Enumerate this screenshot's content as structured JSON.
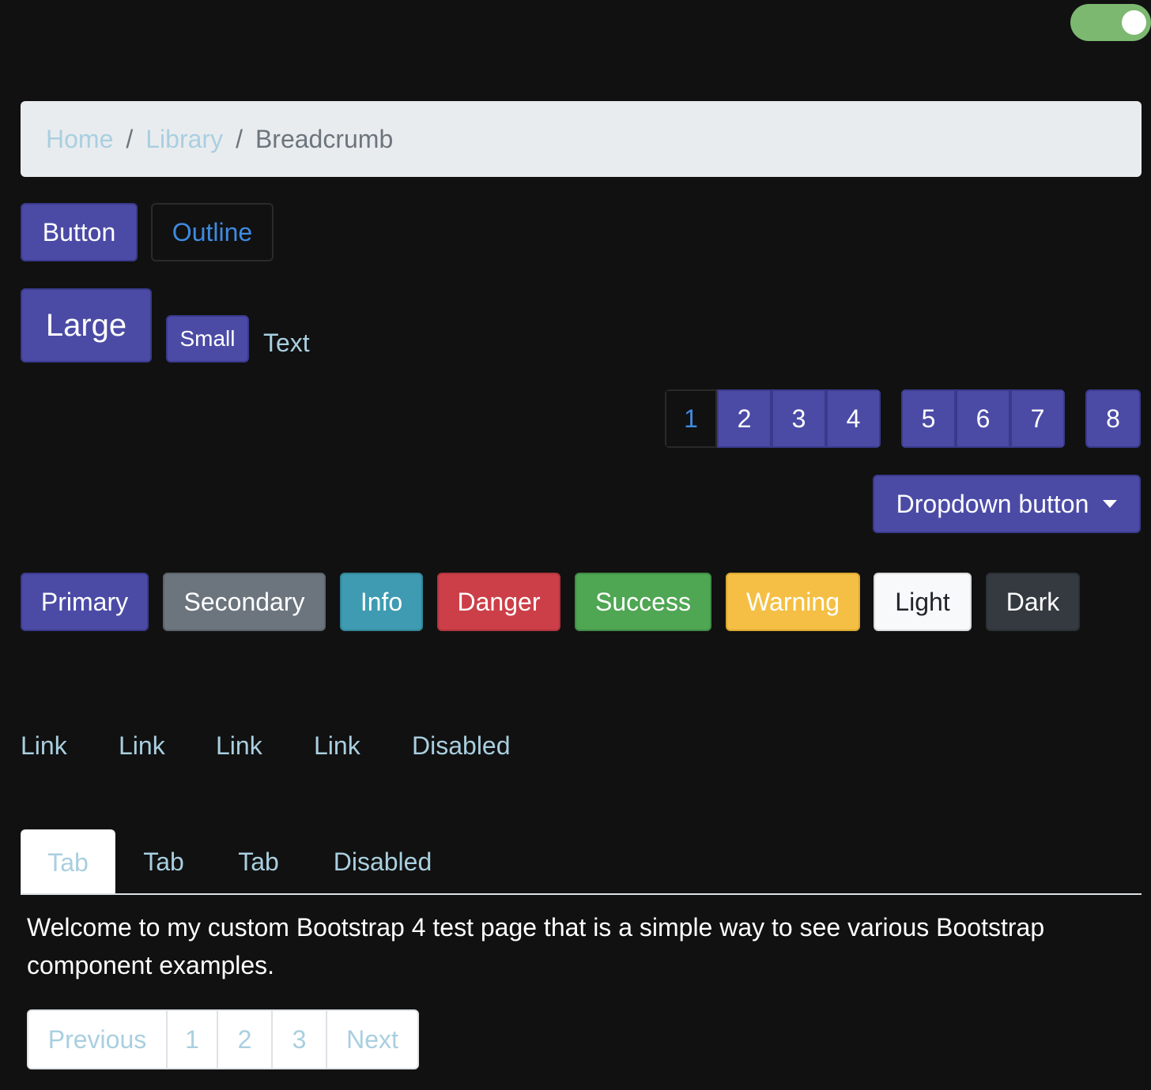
{
  "breadcrumb": {
    "home": "Home",
    "library": "Library",
    "current": "Breadcrumb",
    "separator": "/"
  },
  "buttons": {
    "button": "Button",
    "outline": "Outline",
    "large": "Large",
    "small": "Small",
    "text": "Text"
  },
  "pagination_group": [
    "1",
    "2",
    "3",
    "4",
    "5",
    "6",
    "7",
    "8"
  ],
  "dropdown": {
    "label": "Dropdown button"
  },
  "color_buttons": [
    "Primary",
    "Secondary",
    "Info",
    "Danger",
    "Success",
    "Warning",
    "Light",
    "Dark"
  ],
  "nav_links": [
    "Link",
    "Link",
    "Link",
    "Link",
    "Disabled"
  ],
  "tabs": [
    "Tab",
    "Tab",
    "Tab",
    "Disabled"
  ],
  "content": {
    "text": "Welcome to my custom Bootstrap 4 test page that is a simple way to see various Bootstrap component examples."
  },
  "pagination": {
    "previous": "Previous",
    "pages": [
      "1",
      "2",
      "3"
    ],
    "next": "Next"
  },
  "colors": {
    "background": "#111111",
    "primary": "#4b4ba6",
    "secondary": "#6c757d",
    "info": "#3e9bb1",
    "danger": "#cc3f48",
    "success": "#4fa653",
    "warning": "#f4bf44",
    "light": "#f8f9fa",
    "dark": "#343a40",
    "link": "#a9cfe0",
    "toggle_on": "#7cb870"
  }
}
